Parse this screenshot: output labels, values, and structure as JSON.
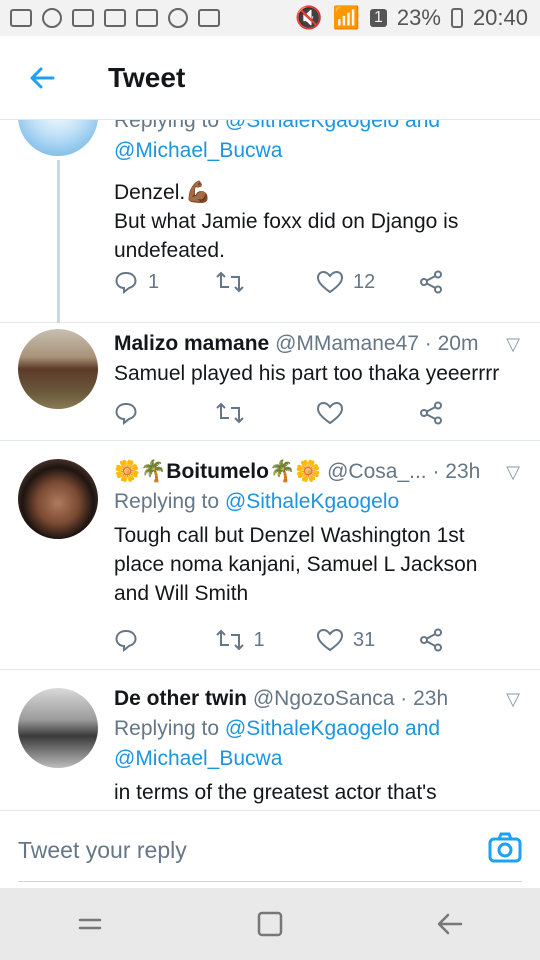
{
  "status_bar": {
    "battery": "23%",
    "time": "20:40",
    "notification_count": "1"
  },
  "header": {
    "title": "Tweet"
  },
  "tweets": [
    {
      "reply_to_prefix": "Replying to",
      "reply_to_line1": "@SithaleKgaogelo and",
      "reply_to_line2": "@Michael_Bucwa",
      "text_line1": "Denzel.💪🏾",
      "text_line2": "But what Jamie foxx did on Django is",
      "text_line3": "undefeated.",
      "replies": "1",
      "retweets": "",
      "likes": "12"
    },
    {
      "name": "Malizo mamane",
      "handle": "@MMamane47",
      "time": "· 20m",
      "text_line1": "Samuel played his part too thaka yeeerrrr",
      "replies": "",
      "retweets": "",
      "likes": ""
    },
    {
      "name": "🌼🌴Boitumelo🌴🌼",
      "handle": "@Cosa_...",
      "time": "· 23h",
      "reply_to_prefix": "Replying to",
      "reply_to_line1": "@SithaleKgaogelo",
      "text_line1": "Tough call but Denzel Washington 1st",
      "text_line2": "place noma kanjani, Samuel L Jackson",
      "text_line3": "and Will Smith",
      "replies": "",
      "retweets": "1",
      "likes": "31"
    },
    {
      "name": "De other twin",
      "handle": "@NgozoSanca",
      "time": "· 23h",
      "reply_to_prefix": "Replying to",
      "reply_to_line1": "@SithaleKgaogelo and",
      "reply_to_line2": "@Michael_Bucwa",
      "text_line1": "in terms of the greatest actor that's"
    }
  ],
  "reply_bar": {
    "placeholder": "Tweet your reply"
  },
  "colors": {
    "accent": "#1da1f2",
    "link": "#1b95e0",
    "muted": "#657786"
  }
}
